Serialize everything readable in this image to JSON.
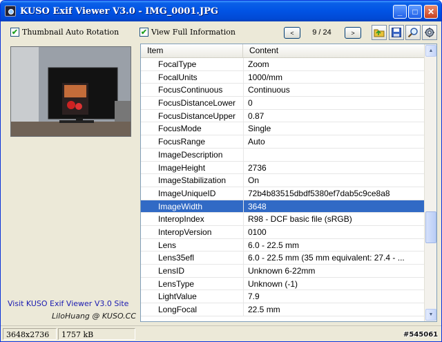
{
  "window": {
    "title": "KUSO Exif Viewer V3.0 - IMG_0001.JPG",
    "minimize_label": "_",
    "maximize_label": "□",
    "close_label": "✕"
  },
  "options": {
    "thumbnail_auto_rotation": {
      "label": "Thumbnail Auto Rotation",
      "checked": true
    },
    "view_full_information": {
      "label": "View Full Information",
      "checked": true
    }
  },
  "navigation": {
    "prev_label": "<",
    "next_label": ">",
    "page_indicator": "9 / 24"
  },
  "toolbar": {
    "icons": [
      "open-folder-icon",
      "save-icon",
      "zoom-icon",
      "settings-icon"
    ]
  },
  "sidebar": {
    "visit_link": "Visit KUSO Exif Viewer V3.0 Site",
    "credit": "LiloHuang @ KUSO.CC"
  },
  "table": {
    "columns": [
      "Item",
      "Content"
    ],
    "selected_index": 11,
    "rows": [
      {
        "item": "FocalType",
        "content": "Zoom"
      },
      {
        "item": "FocalUnits",
        "content": "1000/mm"
      },
      {
        "item": "FocusContinuous",
        "content": "Continuous"
      },
      {
        "item": "FocusDistanceLower",
        "content": "0"
      },
      {
        "item": "FocusDistanceUpper",
        "content": "0.87"
      },
      {
        "item": "FocusMode",
        "content": "Single"
      },
      {
        "item": "FocusRange",
        "content": "Auto"
      },
      {
        "item": "ImageDescription",
        "content": ""
      },
      {
        "item": "ImageHeight",
        "content": "2736"
      },
      {
        "item": "ImageStabilization",
        "content": "On"
      },
      {
        "item": "ImageUniqueID",
        "content": "72b4b83515dbdf5380ef7dab5c9ce8a8"
      },
      {
        "item": "ImageWidth",
        "content": "3648"
      },
      {
        "item": "InteropIndex",
        "content": "R98 - DCF basic file (sRGB)"
      },
      {
        "item": "InteropVersion",
        "content": "0100"
      },
      {
        "item": "Lens",
        "content": "6.0 - 22.5 mm"
      },
      {
        "item": "Lens35efl",
        "content": "6.0 - 22.5 mm (35 mm equivalent: 27.4 - ..."
      },
      {
        "item": "LensID",
        "content": "Unknown 6-22mm"
      },
      {
        "item": "LensType",
        "content": "Unknown (-1)"
      },
      {
        "item": "LightValue",
        "content": "7.9"
      },
      {
        "item": "LongFocal",
        "content": "22.5 mm"
      }
    ]
  },
  "status": {
    "dimensions": "3648x2736",
    "file_size": "1757 kB"
  },
  "watermark": "#545061",
  "colors": {
    "selection": "#316ac5",
    "titlebar": "#0153e4",
    "link": "#1a1ab0"
  }
}
